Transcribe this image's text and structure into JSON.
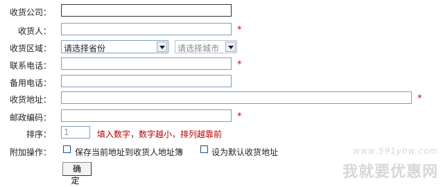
{
  "form": {
    "company": {
      "label": "收货公司：",
      "value": ""
    },
    "receiver": {
      "label": "收货人：",
      "value": "",
      "required": "*"
    },
    "region": {
      "label": "收货区域：",
      "province": "请选择省份",
      "city": "请选择城市"
    },
    "phone": {
      "label": "联系电话：",
      "value": "",
      "required": "*"
    },
    "backup_phone": {
      "label": "备用电话：",
      "value": ""
    },
    "address": {
      "label": "收货地址：",
      "value": "",
      "required": "*"
    },
    "postcode": {
      "label": "邮政编码：",
      "value": "",
      "required": "*"
    },
    "order": {
      "label": "排序：",
      "value": "1",
      "hint": "填入数字，数字越小，排列越靠前"
    },
    "extra": {
      "label": "附加操作：",
      "save_to_book": "保存当前地址到收货人地址簿",
      "set_default": "设为默认收货地址"
    },
    "submit_label": "确 定"
  },
  "watermark": {
    "url": "www.591yhw.com",
    "name": "我就要优惠网"
  },
  "colors": {
    "required": "#d40000",
    "hint": "#b40000",
    "input_border": "#7f9db9"
  }
}
